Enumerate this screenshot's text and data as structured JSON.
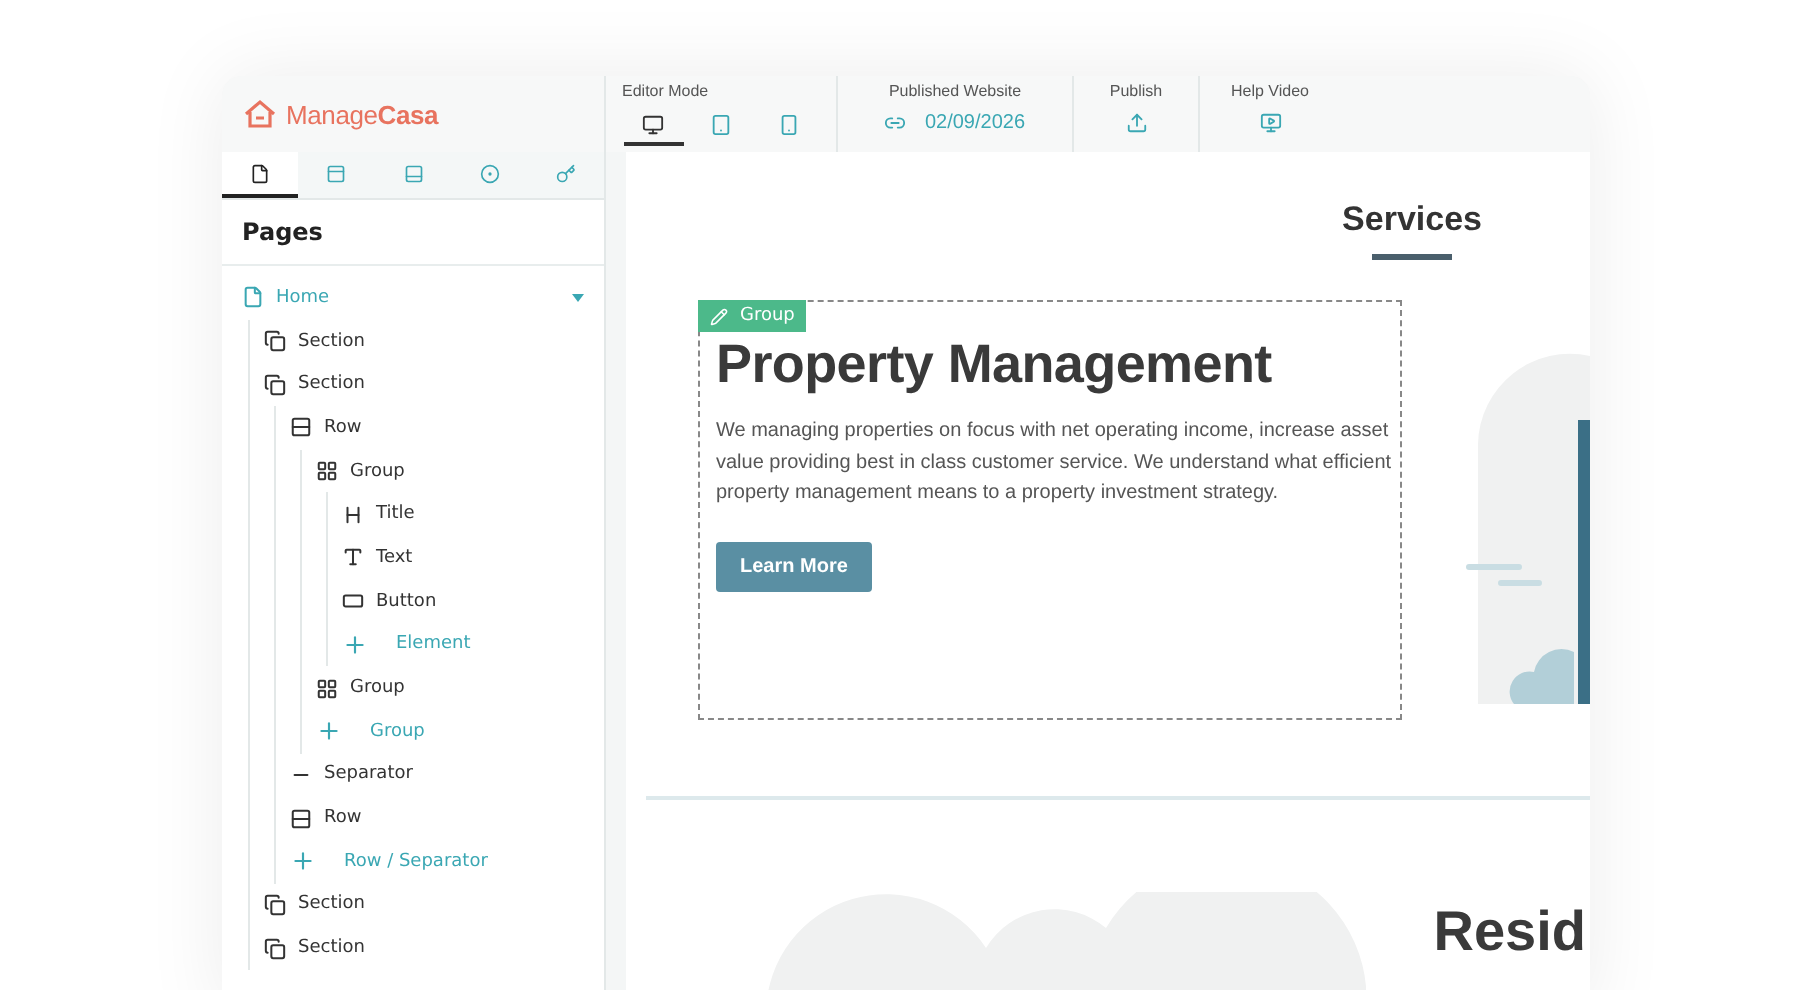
{
  "logo": {
    "part_1": "Manage",
    "part_2": "Casa"
  },
  "sidebar": {
    "tabs": [
      {
        "kind": "page",
        "selected": true
      },
      {
        "kind": "header",
        "selected": false
      },
      {
        "kind": "footer",
        "selected": false
      },
      {
        "kind": "settings",
        "selected": false
      },
      {
        "kind": "key",
        "selected": false
      }
    ],
    "title": "Pages",
    "tree": [
      {
        "label": "Home",
        "kind": "page",
        "expanded": true,
        "children": [
          {
            "label": "Section",
            "kind": "section"
          },
          {
            "label": "Section",
            "kind": "section",
            "children": [
              {
                "label": "Row",
                "kind": "row",
                "children": [
                  {
                    "label": "Group",
                    "kind": "group",
                    "children": [
                      {
                        "label": "Title",
                        "kind": "title"
                      },
                      {
                        "label": "Text",
                        "kind": "text"
                      },
                      {
                        "label": "Button",
                        "kind": "button"
                      },
                      {
                        "label": "Element",
                        "kind": "add"
                      }
                    ]
                  },
                  {
                    "label": "Group",
                    "kind": "group"
                  },
                  {
                    "label": "Group",
                    "kind": "add"
                  }
                ]
              },
              {
                "label": "Separator",
                "kind": "separator"
              },
              {
                "label": "Row",
                "kind": "row"
              },
              {
                "label": "Row / Separator",
                "kind": "add"
              }
            ]
          },
          {
            "label": "Section",
            "kind": "section"
          },
          {
            "label": "Section",
            "kind": "section"
          }
        ]
      }
    ]
  },
  "toolbar": {
    "editor_mode": {
      "label": "Editor Mode",
      "devices": [
        {
          "kind": "desktop",
          "selected": true
        },
        {
          "kind": "tablet",
          "selected": false
        },
        {
          "kind": "phone",
          "selected": false
        }
      ]
    },
    "published": {
      "label": "Published Website",
      "date": "02/09/2026"
    },
    "publish": {
      "label": "Publish"
    },
    "help": {
      "label": "Help Video"
    }
  },
  "canvas": {
    "services_heading": "Services",
    "group_tag": "Group",
    "title": "Property Management",
    "body": "We managing properties on focus with net operating income, increase asset value providing best in class customer service. We understand what efficient property management means to a property investment strategy.",
    "cta": "Learn More",
    "next_heading": "Resid"
  }
}
